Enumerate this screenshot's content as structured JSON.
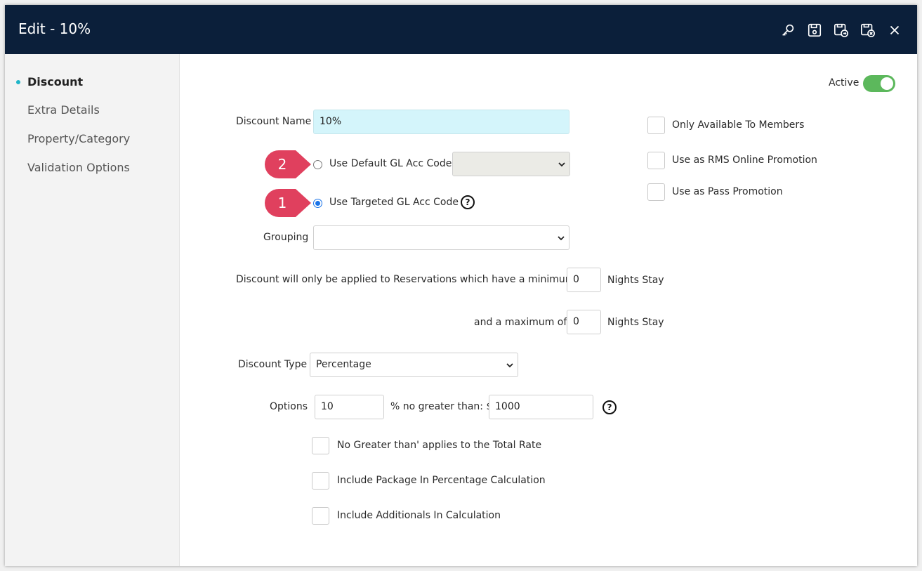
{
  "window": {
    "title": "Edit - 10%"
  },
  "toolbar": {
    "icons": [
      "key-icon",
      "save-icon",
      "save-next-icon",
      "save-close-icon",
      "close-icon"
    ]
  },
  "sidebar": {
    "items": [
      {
        "label": "Discount",
        "active": true
      },
      {
        "label": "Extra Details",
        "active": false
      },
      {
        "label": "Property/Category",
        "active": false
      },
      {
        "label": "Validation Options",
        "active": false
      }
    ]
  },
  "form": {
    "active_label": "Active",
    "active_on": true,
    "discount_name_label": "Discount Name",
    "discount_name_value": "10%",
    "use_default_gl_label": "Use Default GL Acc Code",
    "use_targeted_gl_label": "Use Targeted GL Acc Code",
    "default_gl_value": "",
    "grouping_label": "Grouping",
    "grouping_value": "",
    "min_nights_label": "Discount will only be applied to Reservations which have a minimum of",
    "min_nights_value": "0",
    "max_nights_label": "and a maximum of",
    "max_nights_value": "0",
    "nights_stay_label": "Nights Stay",
    "discount_type_label": "Discount Type",
    "discount_type_value": "Percentage",
    "options_label": "Options",
    "options_percent_value": "10",
    "no_greater_than_label": "% no greater than: $",
    "no_greater_than_value": "1000",
    "checkbox_total_rate_label": "No Greater than' applies to the Total Rate",
    "checkbox_package_label": "Include Package In Percentage Calculation",
    "checkbox_additionals_label": "Include Additionals In Calculation",
    "members_only_label": "Only Available To Members",
    "rms_online_label": "Use as RMS Online Promotion",
    "pass_promotion_label": "Use as Pass Promotion"
  },
  "annotations": {
    "badge_1": "1",
    "badge_2": "2",
    "badge_color": "#e0405e"
  },
  "colors": {
    "titlebar": "#0b1f3a",
    "accent": "#1fb5c8",
    "toggle_on": "#5cb85c"
  }
}
